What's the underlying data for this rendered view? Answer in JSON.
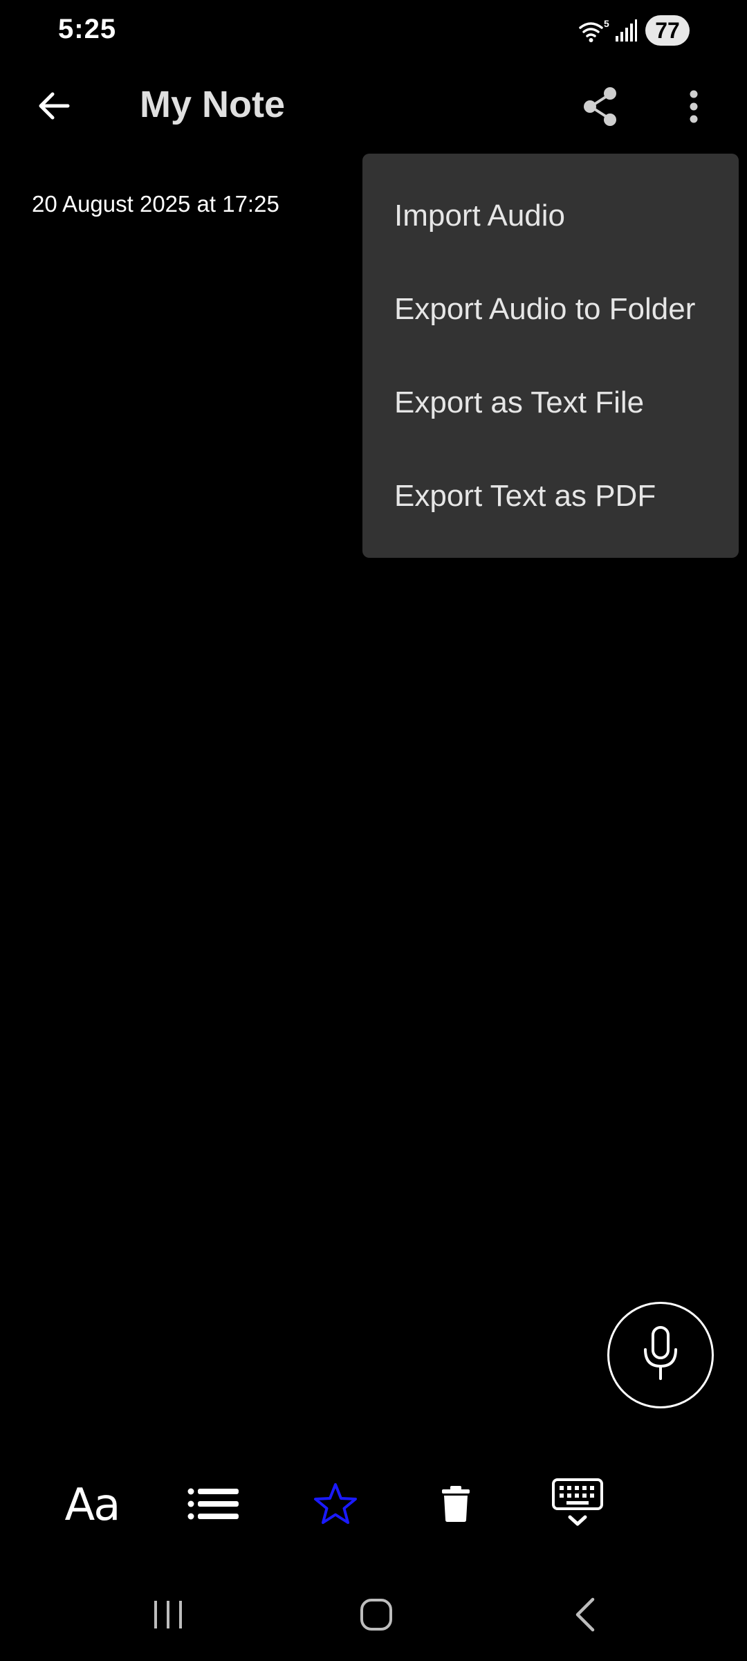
{
  "status_bar": {
    "time": "5:25",
    "network_label": "5",
    "battery_level": "77"
  },
  "app_bar": {
    "title": "My Note",
    "icons": {
      "back": "back-arrow-icon",
      "share": "share-icon",
      "more": "more-vertical-icon"
    }
  },
  "note": {
    "date": "20 August 2025 at 17:25"
  },
  "menu": {
    "items": [
      {
        "label": "Import Audio"
      },
      {
        "label": "Export Audio to Folder"
      },
      {
        "label": "Export as Text File"
      },
      {
        "label": "Export Text as PDF"
      }
    ]
  },
  "fab": {
    "icon": "microphone-icon"
  },
  "toolbar": {
    "text_format_label": "Aa",
    "icons": [
      "text-format-icon",
      "list-icon",
      "star-icon",
      "trash-icon",
      "keyboard-hide-icon"
    ],
    "star_color": "#1a1aff"
  },
  "nav_bar": {
    "icons": [
      "recent-apps-icon",
      "home-icon",
      "nav-back-icon"
    ]
  },
  "colors": {
    "background": "#000000",
    "menu_background": "#333333",
    "menu_text": "#e6e6e6",
    "title_text": "#e0e0e0"
  }
}
